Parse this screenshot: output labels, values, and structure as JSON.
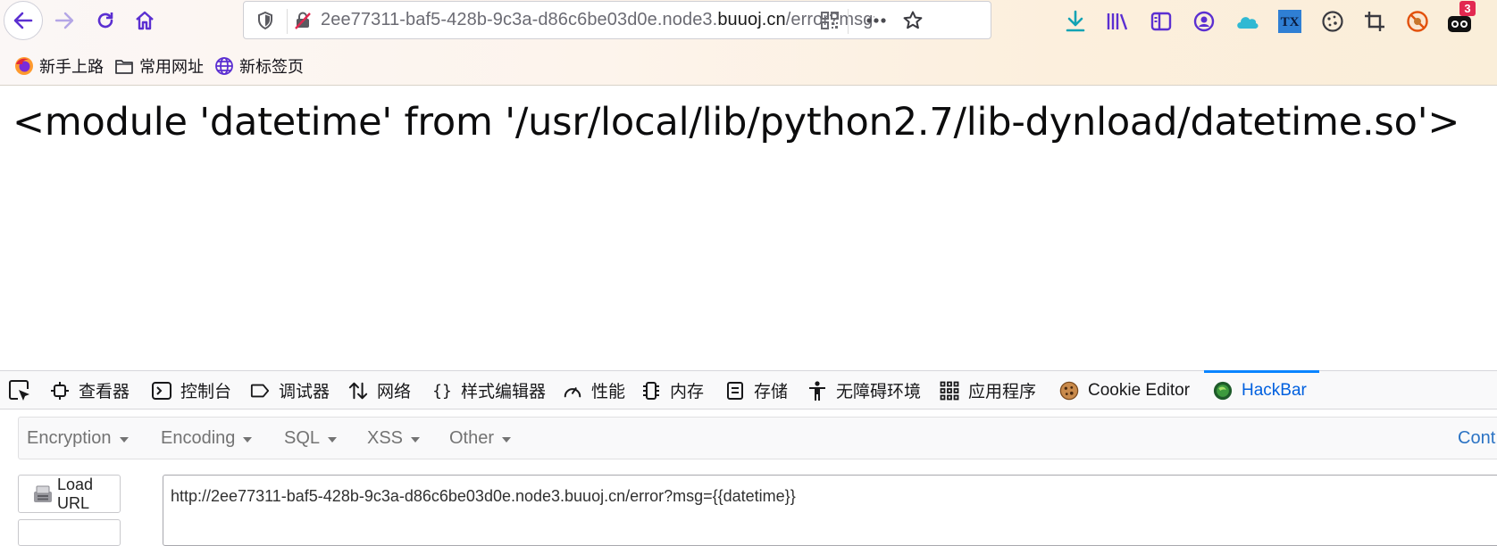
{
  "toolbar": {
    "url_prefix": "2ee77311-baf5-428b-9c3a-d86c6be03d0e.node3.",
    "url_domain": "buuoj.cn",
    "url_suffix": "/error?msg={{datetime}}",
    "badge_count": "3"
  },
  "bookmarks": [
    {
      "label": "新手上路",
      "icon": "firefox-icon"
    },
    {
      "label": "常用网址",
      "icon": "folder-icon"
    },
    {
      "label": "新标签页",
      "icon": "globe-icon"
    }
  ],
  "page": {
    "output": "<module 'datetime' from '/usr/local/lib/python2.7/lib-dynload/datetime.so'>"
  },
  "devtools": {
    "tabs": [
      {
        "label": "查看器",
        "icon": "inspector-icon"
      },
      {
        "label": "控制台",
        "icon": "console-icon"
      },
      {
        "label": "调试器",
        "icon": "debugger-icon"
      },
      {
        "label": "网络",
        "icon": "network-icon"
      },
      {
        "label": "样式编辑器",
        "icon": "style-editor-icon"
      },
      {
        "label": "性能",
        "icon": "performance-icon"
      },
      {
        "label": "内存",
        "icon": "memory-icon"
      },
      {
        "label": "存储",
        "icon": "storage-icon"
      },
      {
        "label": "无障碍环境",
        "icon": "accessibility-icon"
      },
      {
        "label": "应用程序",
        "icon": "application-icon"
      },
      {
        "label": "Cookie Editor",
        "icon": "cookie-icon"
      },
      {
        "label": "HackBar",
        "icon": "hackbar-icon",
        "active": true
      }
    ]
  },
  "hackbar": {
    "menus": [
      "Encryption",
      "Encoding",
      "SQL",
      "XSS",
      "Other"
    ],
    "right_link": "Cont",
    "load_url_label": "Load URL",
    "url_value": "http://2ee77311-baf5-428b-9c3a-d86c6be03d0e.node3.buuoj.cn/error?msg={{datetime}}"
  },
  "colors": {
    "accent": "#0a84ff",
    "toolbar_icon": "#5b2fd1",
    "download_icon": "#12a3b4",
    "badge": "#e22850"
  }
}
